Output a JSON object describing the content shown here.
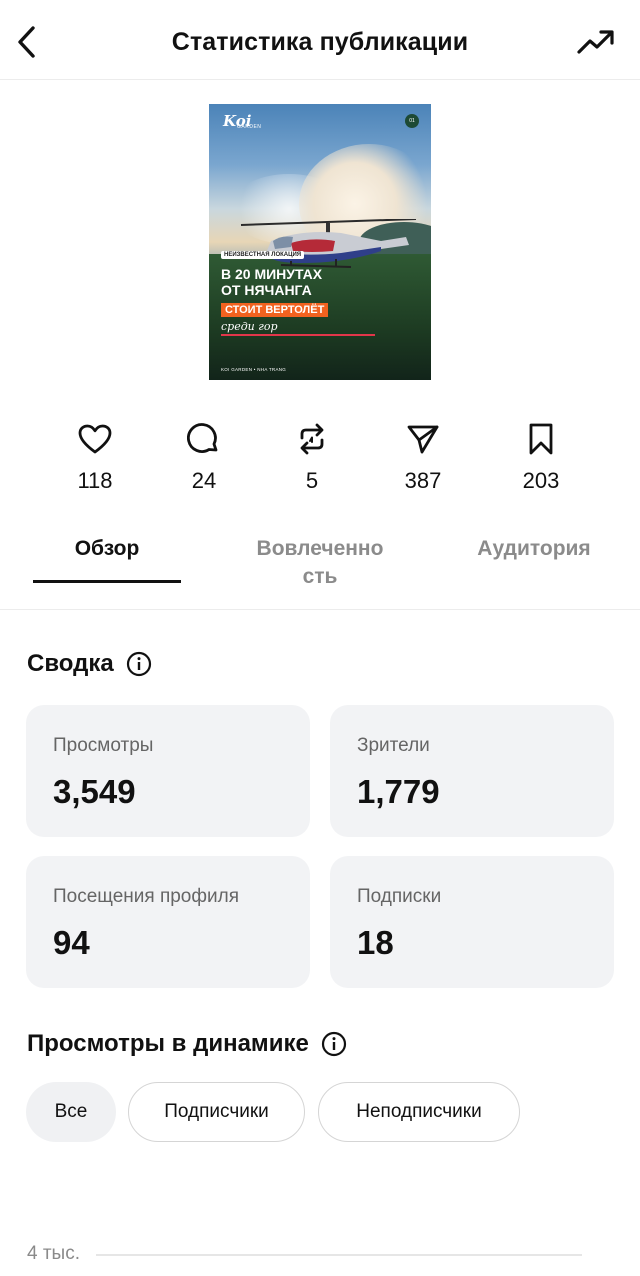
{
  "header": {
    "title": "Статистика публикации",
    "back_icon": "chevron-left-icon",
    "trend_icon": "trending-up-icon"
  },
  "post": {
    "tag": "НЕИЗВЕСТНАЯ ЛОКАЦИЯ",
    "headline_line1": "В 20 МИНУТАХ",
    "headline_line2": "ОТ НЯЧАНГА",
    "highlight": "СТОИТ ВЕРТОЛЁТ",
    "script": "среди гор",
    "footer": "KOI GARDEN • NHA TRANG",
    "logo": "Koi",
    "logo_sub": "GARDEN",
    "badge": "01",
    "accent_color": "#f2621f"
  },
  "stats": [
    {
      "icon": "heart-icon",
      "value": "118"
    },
    {
      "icon": "comment-icon",
      "value": "24"
    },
    {
      "icon": "repost-icon",
      "value": "5"
    },
    {
      "icon": "share-icon",
      "value": "387"
    },
    {
      "icon": "bookmark-icon",
      "value": "203"
    }
  ],
  "tabs": [
    {
      "label": "Обзор",
      "active": true
    },
    {
      "label": "Вовлеченно\nсть",
      "active": false
    },
    {
      "label": "Аудитория",
      "active": false
    }
  ],
  "summary": {
    "title": "Сводка",
    "cards": [
      {
        "label": "Просмотры",
        "value": "3,549"
      },
      {
        "label": "Зрители",
        "value": "1,779"
      },
      {
        "label": "Посещения профиля",
        "value": "94"
      },
      {
        "label": "Подписки",
        "value": "18"
      }
    ]
  },
  "dynamics": {
    "title": "Просмотры в динамике",
    "chips": [
      {
        "label": "Все",
        "selected": true
      },
      {
        "label": "Подписчики",
        "selected": false
      },
      {
        "label": "Неподписчики",
        "selected": false
      }
    ],
    "axis_top_label": "4 тыс."
  },
  "colors": {
    "card_bg": "#f2f3f5",
    "muted_text": "#8b8b8b"
  }
}
